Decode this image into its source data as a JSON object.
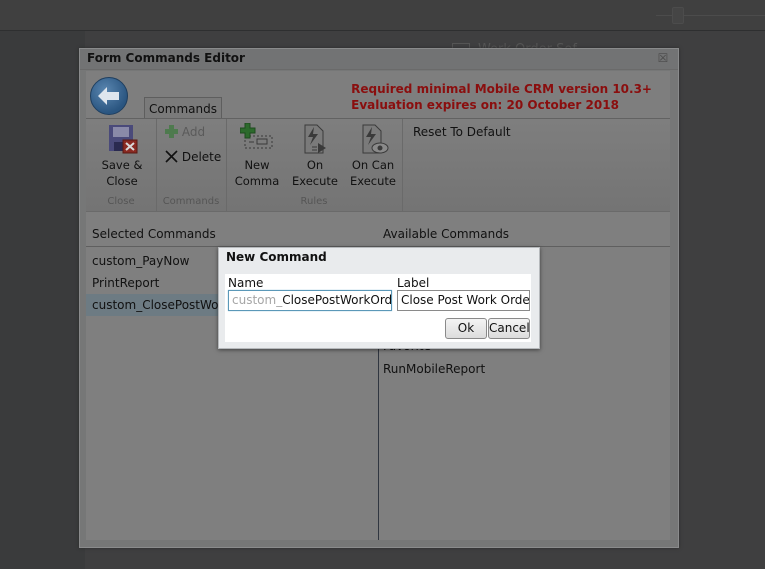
{
  "background": {
    "partial_item_label": "Work Order Sof"
  },
  "editor": {
    "title": "Form Commands Editor",
    "close_icon": "close-icon",
    "tab_label": "Commands",
    "notice_lines": [
      "Required minimal Mobile CRM version 10.3+",
      "Evaluation expires on: 20 October 2018"
    ],
    "notice_color": "#8a0e0e",
    "ribbon": {
      "groups": [
        {
          "label": "Close",
          "buttons": [
            {
              "label_line1": "Save &",
              "label_line2": "Close",
              "icon": "save-close-icon"
            }
          ]
        },
        {
          "label": "Commands",
          "buttons": [
            {
              "label": "Add",
              "icon": "add-icon",
              "enabled": false
            },
            {
              "label": "Delete",
              "icon": "delete-icon",
              "enabled": true
            }
          ]
        },
        {
          "label": "Rules",
          "buttons": [
            {
              "label_line1": "New",
              "label_line2": "Comma",
              "icon": "new-command-icon"
            },
            {
              "label_line1": "On",
              "label_line2": "Execute",
              "icon": "on-execute-icon"
            },
            {
              "label_line1": "On Can",
              "label_line2": "Execute",
              "icon": "on-can-execute-icon"
            }
          ]
        }
      ],
      "reset_label": "Reset To Default"
    },
    "selected_commands": {
      "header": "Selected Commands",
      "items": [
        "custom_PayNow",
        "PrintReport",
        "custom_ClosePostWork"
      ],
      "selected_index": 2
    },
    "available_commands": {
      "header": "Available Commands",
      "items": [
        "Favorite",
        "RunMobileReport"
      ]
    }
  },
  "dialog": {
    "title": "New Command",
    "name_label": "Name",
    "name_prefix": "custom_",
    "name_value": "ClosePostWorkOrder",
    "label_label": "Label",
    "label_value": "Close Post Work Order",
    "ok_label": "Ok",
    "cancel_label": "Cancel"
  }
}
